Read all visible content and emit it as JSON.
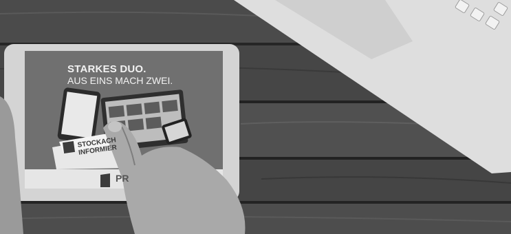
{
  "ad": {
    "headline_line1": "STARKES DUO.",
    "headline_line2": "AUS EINS MACH ZWEI."
  },
  "newspaper": {
    "title_line1": "STOCKACH",
    "title_line2": "INFORMIER"
  },
  "brand_partial": "PR",
  "colors": {
    "table_wood": "#4a4a4a",
    "tablet_frame": "#d9d9d9",
    "ad_background": "#6f6f6f",
    "laptop": "#dcdcdc"
  }
}
